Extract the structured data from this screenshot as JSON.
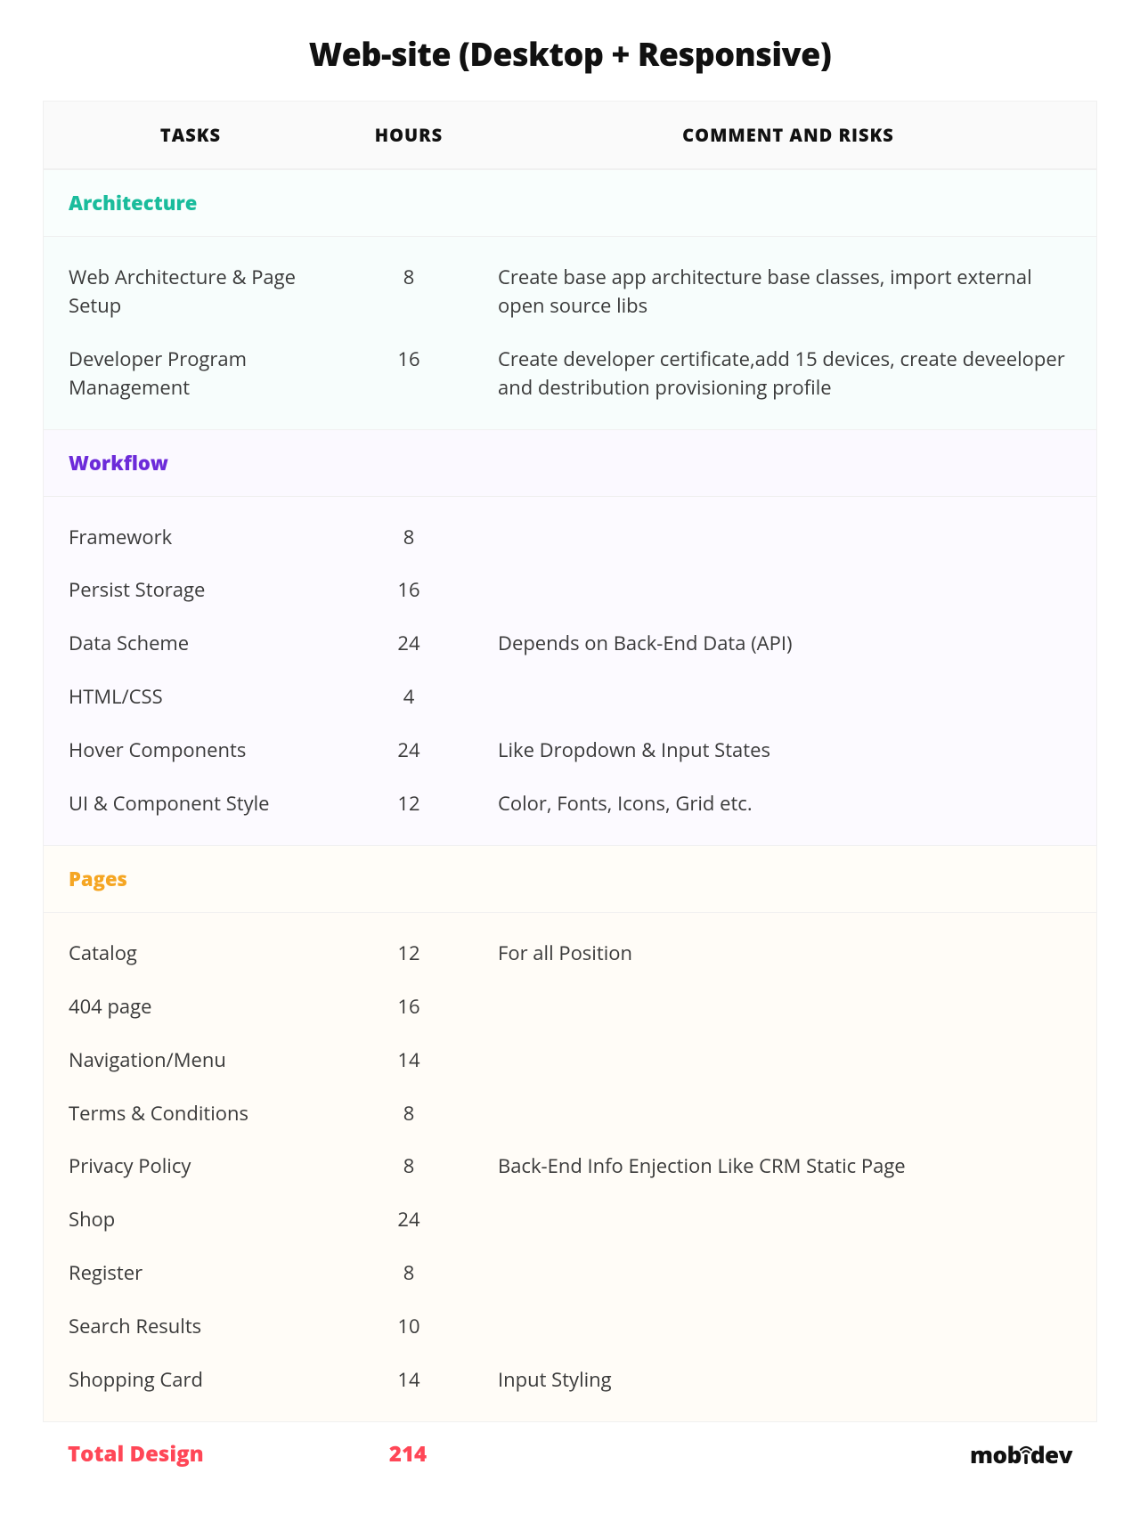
{
  "title": "Web-site (Desktop + Responsive)",
  "columns": {
    "tasks": "TASKS",
    "hours": "HOURS",
    "comment": "COMMENT AND RISKS"
  },
  "sections": [
    {
      "key": "architecture",
      "label": "Architecture",
      "color": "#1abc9c",
      "header_class": "sec-arch",
      "tint_class": "tint-arch",
      "rows": [
        {
          "task": "Web Architecture & Page Setup",
          "hours": "8",
          "comment": "Create base app architecture base classes, import external open source libs"
        },
        {
          "task": "Developer Program Management",
          "hours": "16",
          "comment": "Create developer certificate,add 15 devices, create deveeloper and destribution provisioning profile"
        }
      ]
    },
    {
      "key": "workflow",
      "label": "Workflow",
      "color": "#6c2bd9",
      "header_class": "sec-flow",
      "tint_class": "tint-flow",
      "rows": [
        {
          "task": "Framework",
          "hours": "8",
          "comment": ""
        },
        {
          "task": "Persist Storage",
          "hours": "16",
          "comment": ""
        },
        {
          "task": "Data Scheme",
          "hours": "24",
          "comment": "Depends on Back-End Data (API)"
        },
        {
          "task": "HTML/CSS",
          "hours": "4",
          "comment": ""
        },
        {
          "task": "Hover Components",
          "hours": "24",
          "comment": "Like Dropdown & Input States"
        },
        {
          "task": "UI & Component Style",
          "hours": "12",
          "comment": "Color, Fonts, Icons, Grid etc."
        }
      ]
    },
    {
      "key": "pages",
      "label": "Pages",
      "color": "#f5a623",
      "header_class": "sec-pages",
      "tint_class": "tint-pages",
      "rows": [
        {
          "task": "Catalog",
          "hours": "12",
          "comment": "For all Position"
        },
        {
          "task": "404 page",
          "hours": "16",
          "comment": ""
        },
        {
          "task": "Navigation/Menu",
          "hours": "14",
          "comment": ""
        },
        {
          "task": "Terms & Conditions",
          "hours": "8",
          "comment": ""
        },
        {
          "task": "Privacy Policy",
          "hours": "8",
          "comment": "Back-End Info Enjection Like CRM Static Page"
        },
        {
          "task": "Shop",
          "hours": "24",
          "comment": ""
        },
        {
          "task": "Register",
          "hours": "8",
          "comment": ""
        },
        {
          "task": "Search Results",
          "hours": "10",
          "comment": ""
        },
        {
          "task": "Shopping Card",
          "hours": "14",
          "comment": "Input Styling"
        }
      ]
    }
  ],
  "total": {
    "label": "Total Design",
    "value": "214"
  },
  "brand": {
    "name": "mobidev"
  }
}
